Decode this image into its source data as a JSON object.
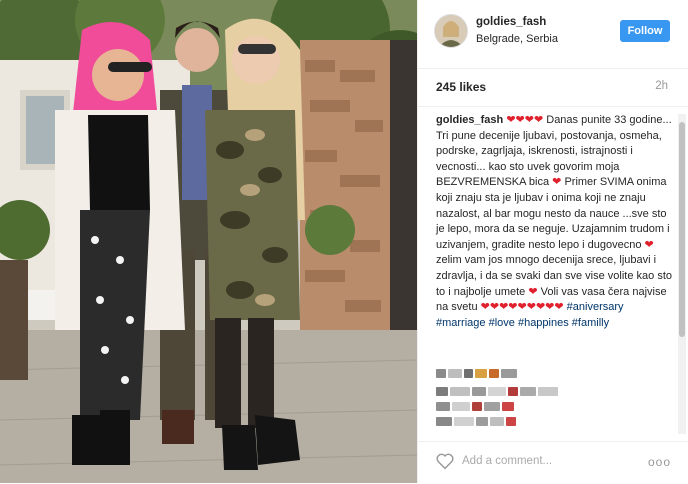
{
  "header": {
    "username": "goldies_fash",
    "location": "Belgrade, Serbia",
    "follow_label": "Follow"
  },
  "stats": {
    "likes": "245 likes",
    "time": "2h"
  },
  "caption": {
    "username": "goldies_fash",
    "text_1": "Danas punite 33 godine... Tri pune decenije ljubavi, postovanja, osmeha, podrske, zagrljaja, iskrenosti, istrajnosti i vecnosti... kao sto uvek govorim moja BEZVREMENSKA bica",
    "text_2": "Primer SVIMA onima koji znaju sta je ljubav i onima koji ne znaju nazalost, al bar mogu nesto da nauce ...sve sto je lepo, mora da se neguje. Uzajamnim trudom i uzivanjem, gradite nesto lepo i dugovecno",
    "text_3": "zelim vam jos mnogo decenija srece, ljubavi i zdravlja, i da se svaki dan sve vise volite kao sto to i najbolje umete",
    "text_4": "Voli vas vasa čera najvise na svetu",
    "hashtags": [
      "#aniversary",
      "#marriage",
      "#love",
      "#happines",
      "#familly"
    ]
  },
  "comment": {
    "placeholder": "Add a comment...",
    "more": "ooo"
  },
  "icons": {
    "heart": "heart-icon",
    "like": "like-outline-icon",
    "more": "more-options-icon"
  },
  "colors": {
    "follow_button": "#3897f0",
    "heart": "#e0212d",
    "hashtag": "#003569"
  }
}
